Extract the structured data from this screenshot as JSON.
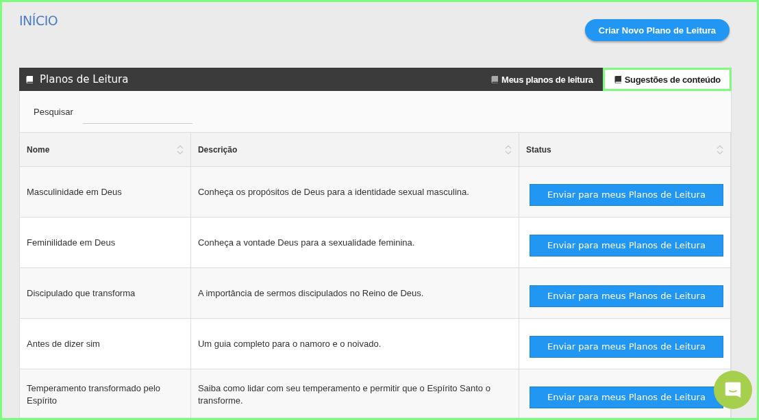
{
  "page_title": "INÍCIO",
  "create_button": "Criar Novo Plano de Leitura",
  "panel": {
    "title": "Planos de Leitura",
    "tabs": [
      {
        "label": "Meus planos de leitura",
        "selected": false
      },
      {
        "label": "Sugestões de conteúdo",
        "selected": true
      }
    ],
    "search": {
      "label": "Pesquisar"
    },
    "table": {
      "columns": [
        "Nome",
        "Descrição",
        "Status"
      ],
      "rows": [
        {
          "name": "Masculinidade em Deus",
          "description": "Conheça os propósitos de Deus para a identidade sexual masculina.",
          "action": "Enviar para meus Planos de Leitura"
        },
        {
          "name": "Feminilidade em Deus",
          "description": "Conheça a vontade Deus para a sexualidade feminina.",
          "action": "Enviar para meus Planos de Leitura"
        },
        {
          "name": "Discipulado que transforma",
          "description": "A importância de sermos discipulados no Reino de Deus.",
          "action": "Enviar para meus Planos de Leitura"
        },
        {
          "name": "Antes de dizer sim",
          "description": "Um guia completo para o namoro e o noivado.",
          "action": "Enviar para meus Planos de Leitura"
        },
        {
          "name": "Temperamento transformado pelo Espírito",
          "description": "Saiba como lidar com seu temperamento e permitir que o Espírito Santo o transforme.",
          "action": "Enviar para meus Planos de Leitura"
        }
      ]
    }
  }
}
